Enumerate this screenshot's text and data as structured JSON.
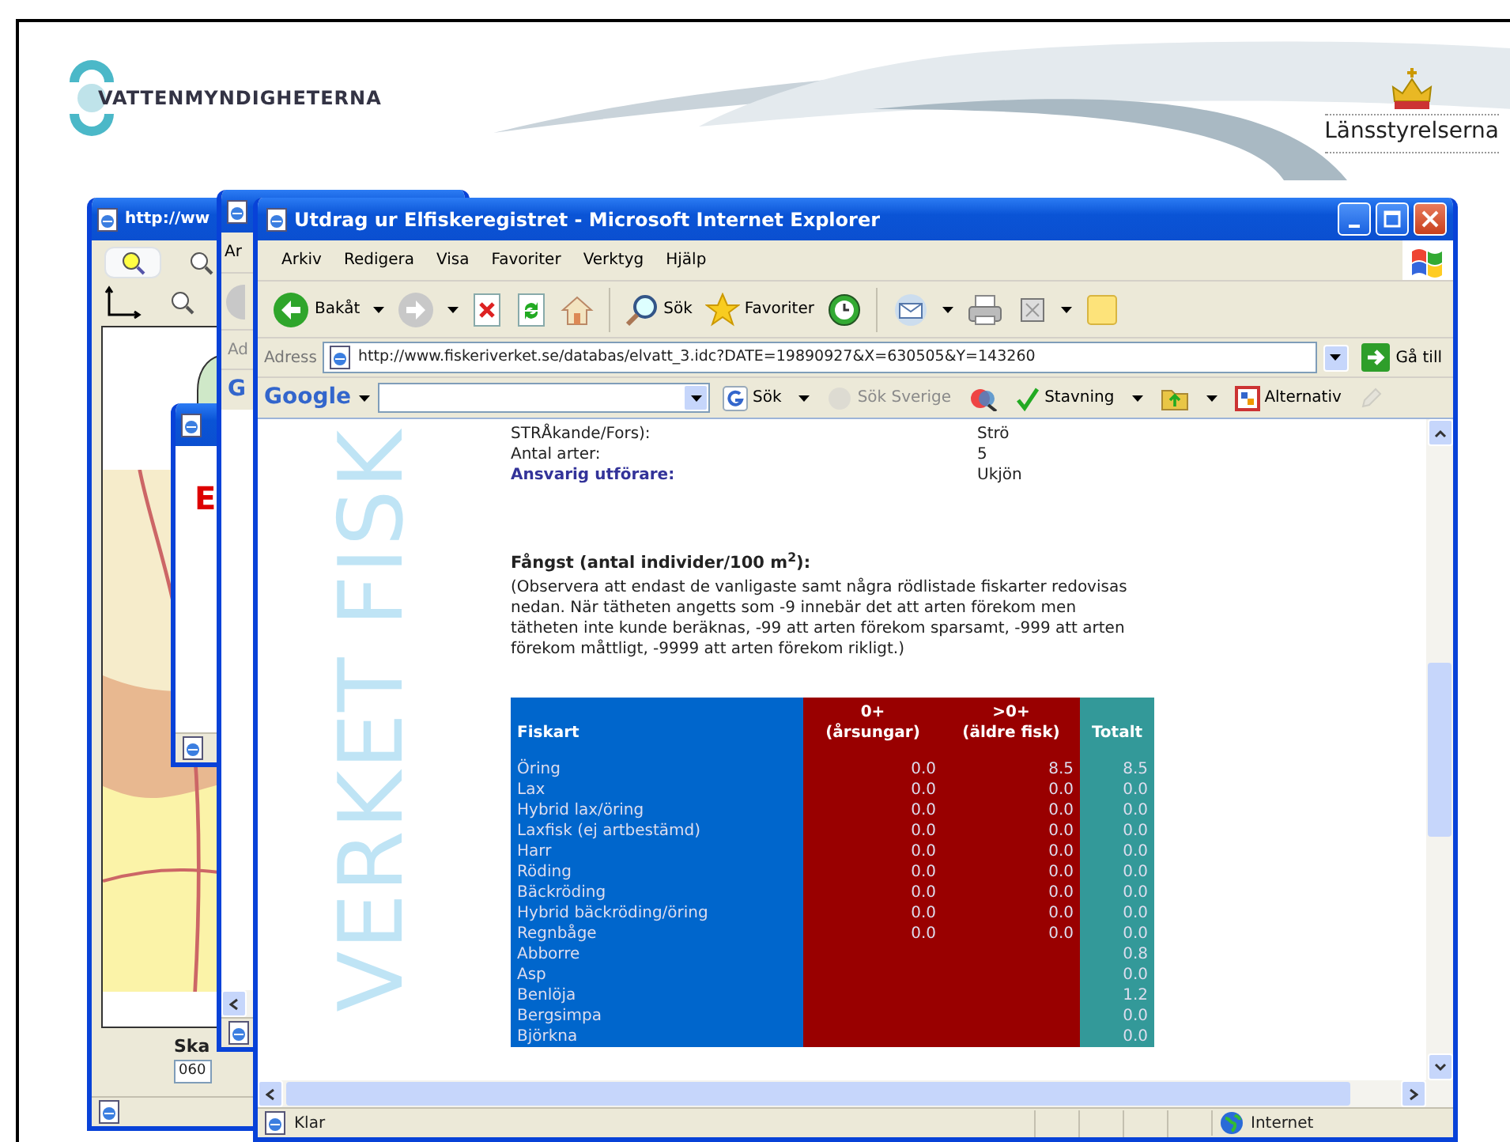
{
  "slide": {
    "logo_text": "VATTENMYNDIGHETERNA",
    "partner_text": "Länsstyrelserna"
  },
  "back_windows": [
    {
      "kind": "map",
      "title": "http://ww",
      "scale_label": "Ska",
      "scale_value": "060"
    },
    {
      "kind": "dialog",
      "heading": "E"
    },
    {
      "kind": "browser",
      "menu_text": "Ar",
      "address_label": "Ad",
      "google_text": "G"
    }
  ],
  "window": {
    "title": "Utdrag ur Elfiskeregistret - Microsoft Internet Explorer",
    "menu": [
      "Arkiv",
      "Redigera",
      "Visa",
      "Favoriter",
      "Verktyg",
      "Hjälp"
    ],
    "toolbar": [
      {
        "kind": "back",
        "label": "Bakåt",
        "dropdown": true
      },
      {
        "kind": "forward",
        "dropdown": true
      },
      {
        "kind": "stop",
        "dropdown": false
      },
      {
        "kind": "refresh",
        "dropdown": false
      },
      {
        "kind": "home",
        "dropdown": false
      },
      {
        "kind": "search",
        "label": "Sök",
        "dropdown": false
      },
      {
        "kind": "favorites",
        "label": "Favoriter",
        "dropdown": false
      },
      {
        "kind": "history",
        "dropdown": false
      },
      {
        "kind": "mail",
        "dropdown": true
      },
      {
        "kind": "print",
        "dropdown": false
      },
      {
        "kind": "edit",
        "dropdown": true
      },
      {
        "kind": "note",
        "dropdown": false
      }
    ],
    "address": {
      "label": "Adress",
      "value": "http://www.fiskeriverket.se/databas/elvatt_3.idc?DATE=19890927&X=630505&Y=143260",
      "go": "Gå till"
    },
    "google_bar": {
      "logo": "Google",
      "buttons": [
        {
          "kind": "search",
          "label": "Sök",
          "dropdown": true,
          "disabled": false
        },
        {
          "kind": "sweden",
          "label": "Sök Sverige",
          "dropdown": false,
          "disabled": true
        },
        {
          "kind": "highlight",
          "dropdown": false,
          "disabled": false
        },
        {
          "kind": "spell",
          "label": "Stavning",
          "dropdown": true,
          "disabled": false
        },
        {
          "kind": "folder",
          "dropdown": true,
          "disabled": false
        },
        {
          "kind": "options",
          "label": "Alternativ",
          "dropdown": false,
          "disabled": false
        },
        {
          "kind": "pencil",
          "dropdown": false,
          "disabled": true
        }
      ]
    },
    "page": {
      "watermark": "VERKET FISK",
      "fields": [
        {
          "label": "STRÅkande/Fors):",
          "value": "Strö",
          "emphasis": false
        },
        {
          "label": "Antal arter:",
          "value": "5",
          "emphasis": false
        },
        {
          "label": "Ansvarig utförare:",
          "value": "Ukjön",
          "emphasis": true
        }
      ],
      "catch_heading": "Fångst (antal individer/100 m$^{2}$):",
      "note": "(Observera att endast de vanligaste samt några rödlistade fiskarter redovisas nedan. När tätheten angetts som -9 innebär det att arten förekom men tätheten inte kunde beräknas, -99 att arten förekom sparsamt, -999 att arten förekom måttligt, -9999 att arten förekom rikligt.)",
      "table": {
        "columns": [
          {
            "color": "#0066cc",
            "lines": [
              "Fiskart"
            ]
          },
          {
            "color": "#990000",
            "lines": [
              "0+",
              "(årsungar)"
            ]
          },
          {
            "color": "#990000",
            "lines": [
              ">0+",
              "(äldre fisk)"
            ]
          },
          {
            "color": "#339999",
            "lines": [
              "Totalt"
            ]
          }
        ],
        "rows": [
          {
            "species": "Öring",
            "young": "0.0",
            "older": "8.5",
            "total": "8.5"
          },
          {
            "species": "Lax",
            "young": "0.0",
            "older": "0.0",
            "total": "0.0"
          },
          {
            "species": "Hybrid lax/öring",
            "young": "0.0",
            "older": "0.0",
            "total": "0.0"
          },
          {
            "species": "Laxfisk (ej artbestämd)",
            "young": "0.0",
            "older": "0.0",
            "total": "0.0"
          },
          {
            "species": "Harr",
            "young": "0.0",
            "older": "0.0",
            "total": "0.0"
          },
          {
            "species": "Röding",
            "young": "0.0",
            "older": "0.0",
            "total": "0.0"
          },
          {
            "species": "Bäckröding",
            "young": "0.0",
            "older": "0.0",
            "total": "0.0"
          },
          {
            "species": "Hybrid bäckröding/öring",
            "young": "0.0",
            "older": "0.0",
            "total": "0.0"
          },
          {
            "species": "Regnbåge",
            "young": "0.0",
            "older": "0.0",
            "total": "0.0"
          },
          {
            "species": "Abborre",
            "total": "0.8"
          },
          {
            "species": "Asp",
            "total": "0.0"
          },
          {
            "species": "Benlöja",
            "total": "1.2"
          },
          {
            "species": "Bergsimpa",
            "total": "0.0"
          },
          {
            "species": "Björkna",
            "total": "0.0"
          }
        ]
      }
    },
    "status": {
      "text": "Klar",
      "zone": "Internet"
    }
  }
}
